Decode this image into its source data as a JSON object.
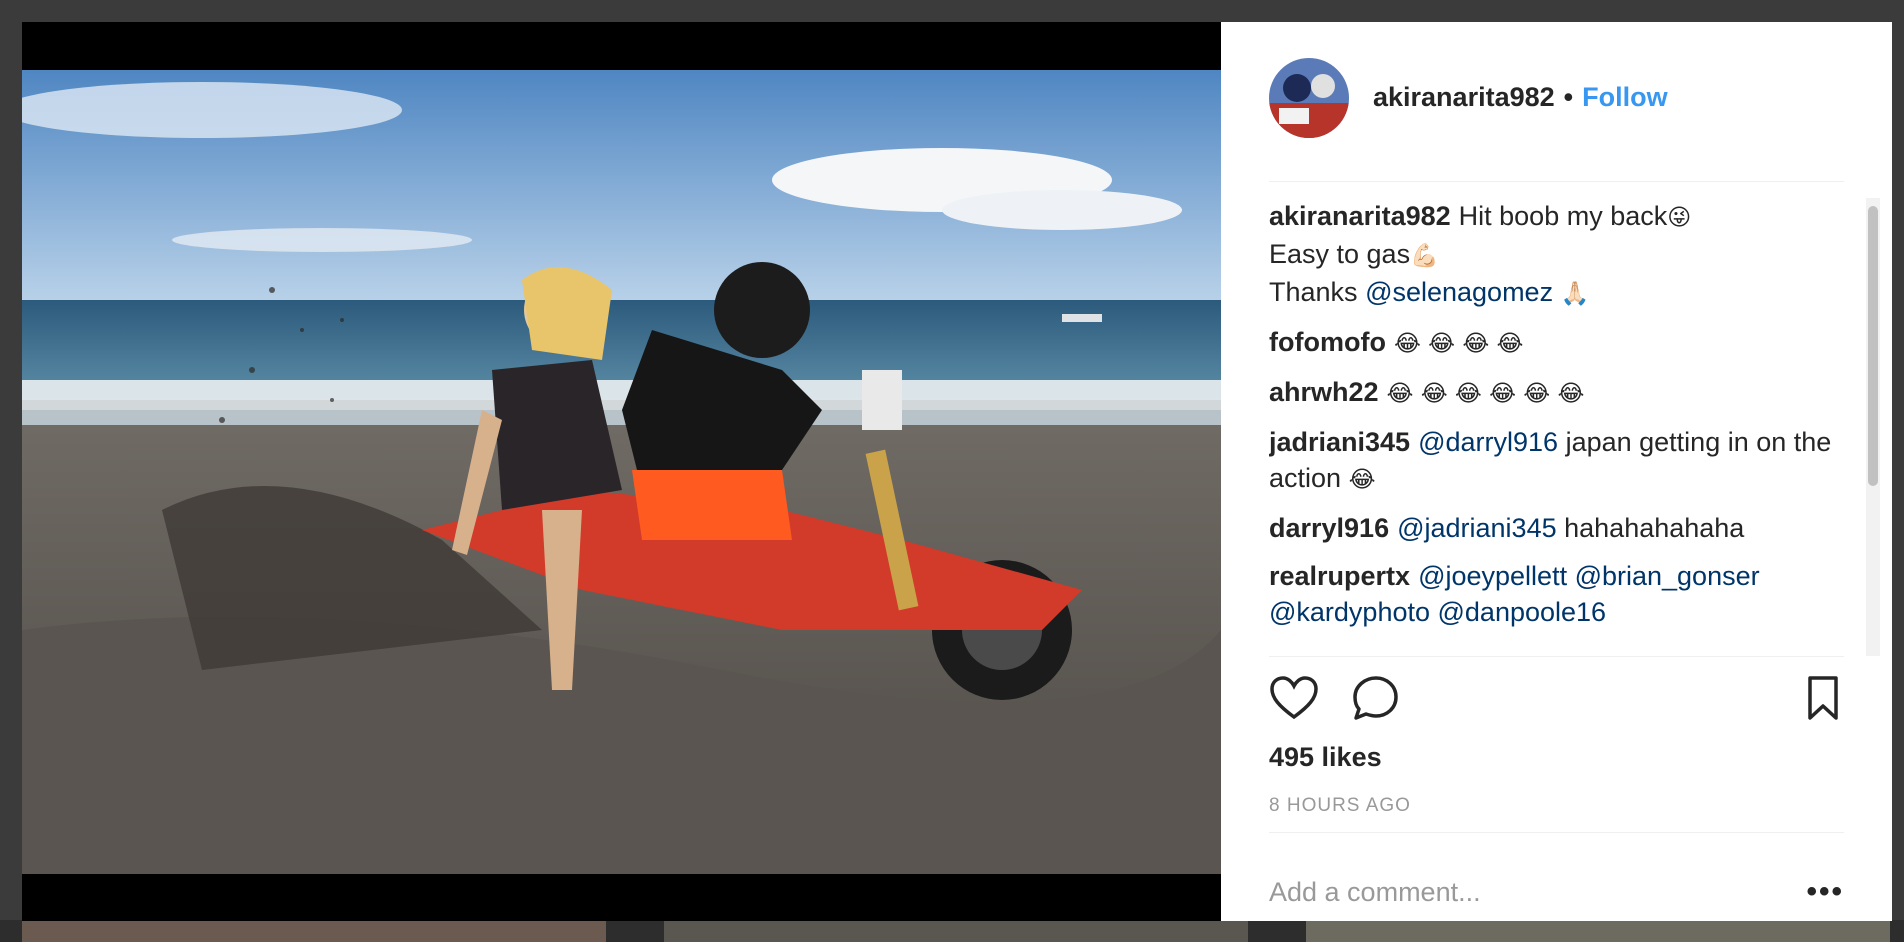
{
  "post": {
    "username": "akiranarita982",
    "separator": "•",
    "follow_label": "Follow",
    "caption": {
      "username": "akiranarita982",
      "line1": "Hit boob my back",
      "line1_emoji": "😜",
      "line2": "Easy to gas",
      "line2_emoji": "💪🏻",
      "line3_prefix": "Thanks",
      "line3_mention": "@selenagomez",
      "line3_emoji": "🙏🏻"
    },
    "comments": [
      {
        "user": "fofomofo",
        "emoji": "😂 😂 😂 😂"
      },
      {
        "user": "ahrwh22",
        "emoji": "😂 😂 😂 😂 😂 😂"
      },
      {
        "user": "jadriani345",
        "mention": "@darryl916",
        "text": "japan getting in on the action",
        "emoji": "😂"
      },
      {
        "user": "darryl916",
        "mention": "@jadriani345",
        "text": "hahahahahaha"
      },
      {
        "user": "realrupertx",
        "mentions": "@joeypellett @brian_gonser @kardyphoto @danpoole16"
      }
    ],
    "likes": "495 likes",
    "time": "8 HOURS AGO",
    "comment_placeholder": "Add a comment...",
    "more_label": "•••"
  },
  "icons": {
    "like": "heart-icon",
    "comment": "speech-bubble-icon",
    "save": "bookmark-icon",
    "more": "ellipsis-icon"
  },
  "colors": {
    "follow": "#3897f0",
    "mention": "#003569",
    "muted": "#999999",
    "text": "#262626"
  }
}
